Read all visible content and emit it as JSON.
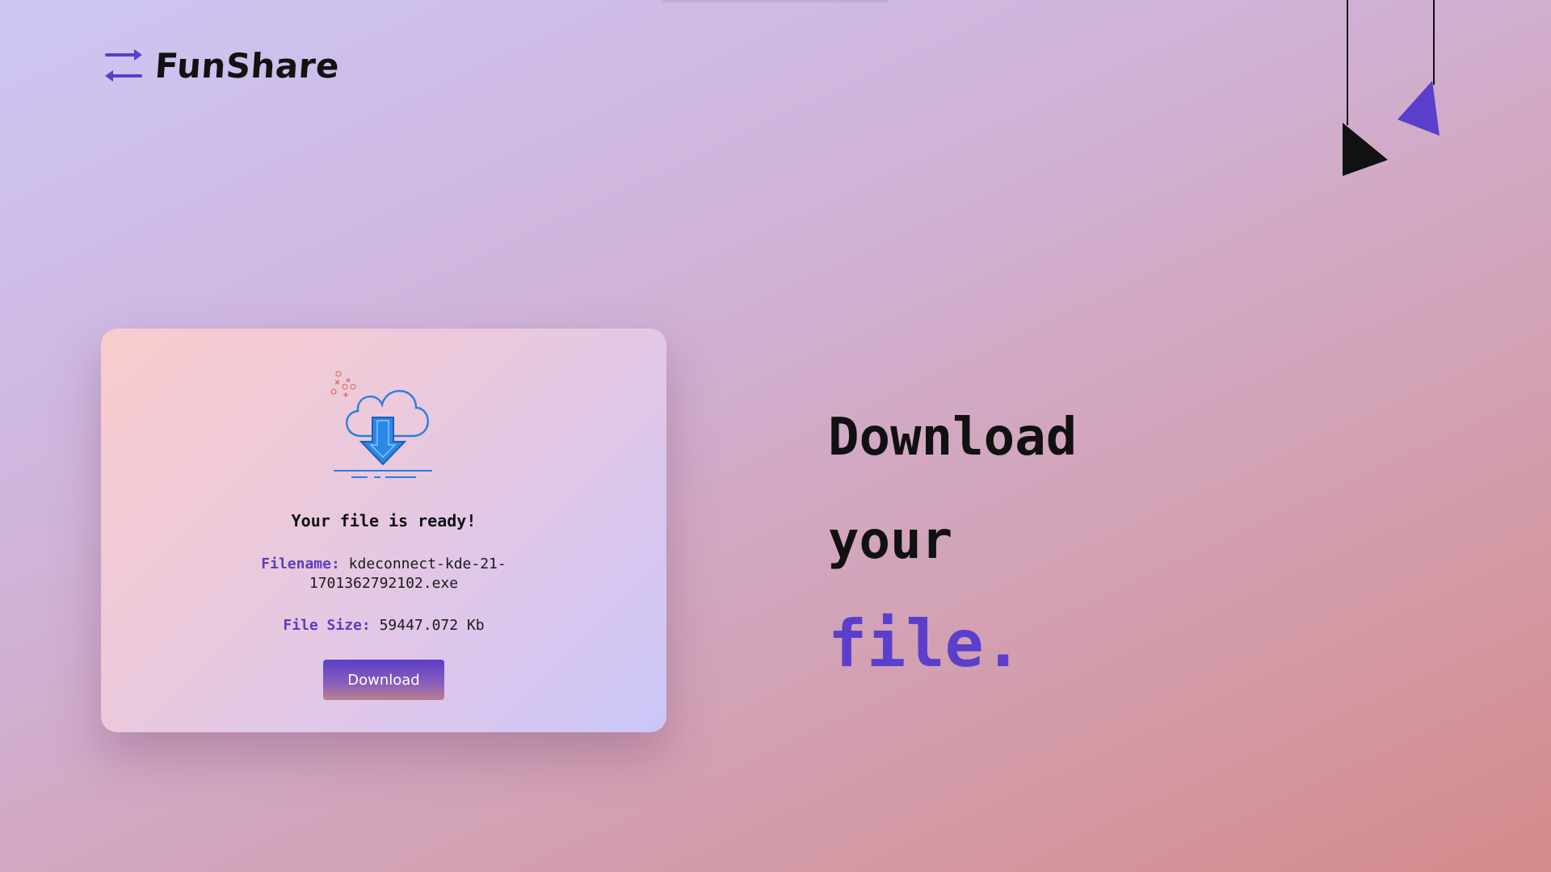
{
  "brand": {
    "name": "FunShare",
    "accent_color": "#5a3fcc"
  },
  "card": {
    "icon": "cloud-download-icon",
    "title": "Your file is ready!",
    "filename_label": "Filename:",
    "filename_value": "kdeconnect-kde-21-1701362792102.exe",
    "filesize_label": "File Size:",
    "filesize_value": "59447.072 Kb",
    "download_label": "Download"
  },
  "headline": {
    "line1": "Download",
    "line2": "your",
    "line3": "file."
  },
  "decorations": {
    "triangle_colors": [
      "#111111",
      "#5a3fcc"
    ]
  }
}
